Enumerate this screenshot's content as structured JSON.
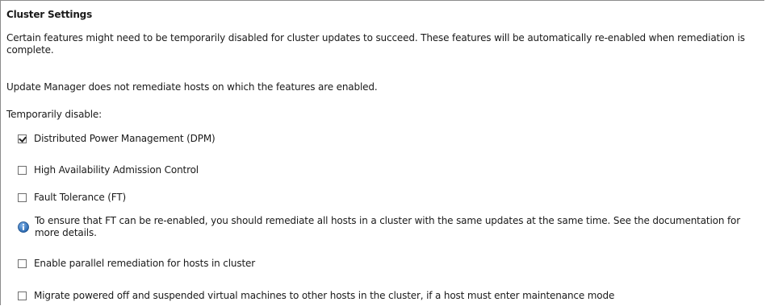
{
  "panel": {
    "title": "Cluster Settings",
    "intro": "Certain features might need to be temporarily disabled for cluster updates to succeed. These features will be automatically re-enabled when remediation is complete.",
    "hosts_note": "Update Manager does not remediate hosts on which the features are enabled.",
    "disable_label": "Temporarily disable:"
  },
  "options": [
    {
      "label": "Distributed Power Management (DPM)",
      "checked": true
    },
    {
      "label": "High Availability Admission Control",
      "checked": false
    },
    {
      "label": "Fault Tolerance (FT)",
      "checked": false
    },
    {
      "label": "Enable parallel remediation for hosts in cluster",
      "checked": false
    },
    {
      "label": "Migrate powered off and suspended virtual machines to other hosts in the cluster, if a host must enter maintenance mode",
      "checked": false
    }
  ],
  "ft_info": {
    "icon": "info-icon",
    "text": "To ensure that FT can be re-enabled, you should remediate all hosts in a cluster with the same updates at the same time. See the documentation for more details."
  },
  "colors": {
    "info_icon": "#1f5fa8",
    "border": "#8c8c8c"
  }
}
